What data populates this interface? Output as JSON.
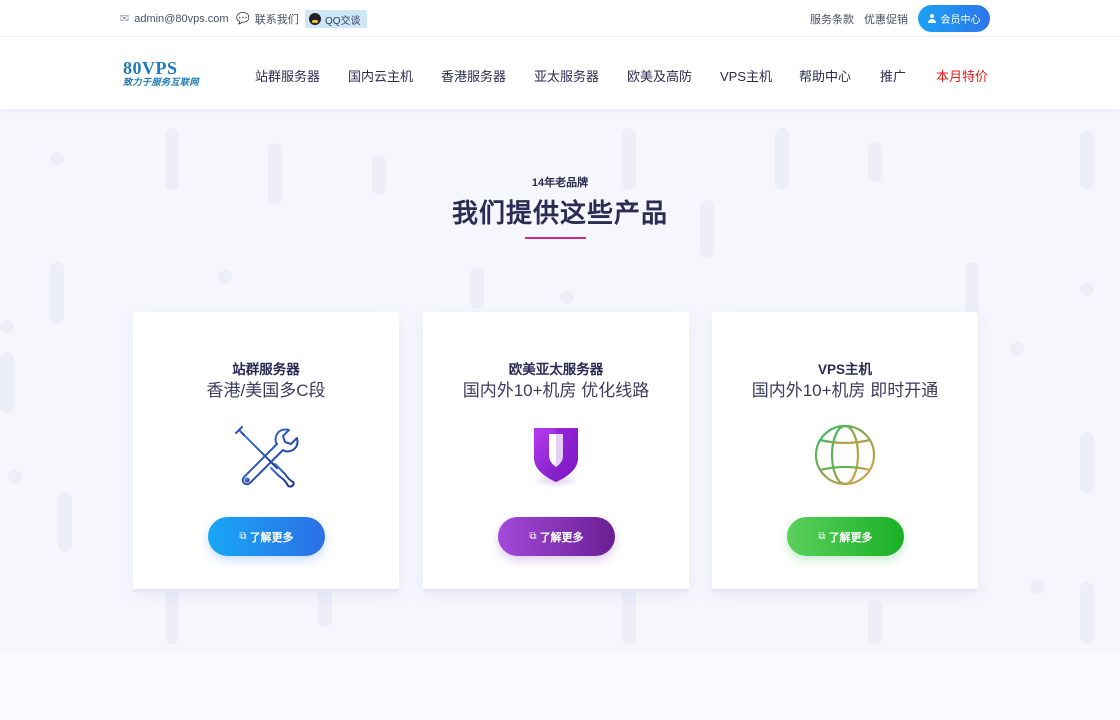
{
  "topbar": {
    "email": "admin@80vps.com",
    "contact": "联系我们",
    "qq": "QQ交谈",
    "terms": "服务条款",
    "promo": "优惠促销",
    "member": "会员中心"
  },
  "logo": {
    "main": "80VPS",
    "tagline": "致力于服务互联网"
  },
  "nav": [
    "站群服务器",
    "国内云主机",
    "香港服务器",
    "亚太服务器",
    "欧美及高防",
    "VPS主机",
    "帮助中心",
    "推广",
    "本月特价"
  ],
  "hero": {
    "eyebrow": "14年老品牌",
    "title": "我们提供这些产品"
  },
  "cards": [
    {
      "title": "站群服务器",
      "subtitle": "香港/美国多C段",
      "icon": "tools-icon",
      "button": "了解更多"
    },
    {
      "title": "欧美亚太服务器",
      "subtitle": "国内外10+机房 优化线路",
      "icon": "shield-icon",
      "button": "了解更多"
    },
    {
      "title": "VPS主机",
      "subtitle": "国内外10+机房 即时开通",
      "icon": "globe-icon",
      "button": "了解更多"
    }
  ],
  "colors": {
    "accent_blue": "#2c6fe6",
    "accent_purple": "#7b2aa8",
    "accent_green": "#19b026",
    "hot_red": "#e51c1c",
    "title_underline": "#d6287c"
  }
}
